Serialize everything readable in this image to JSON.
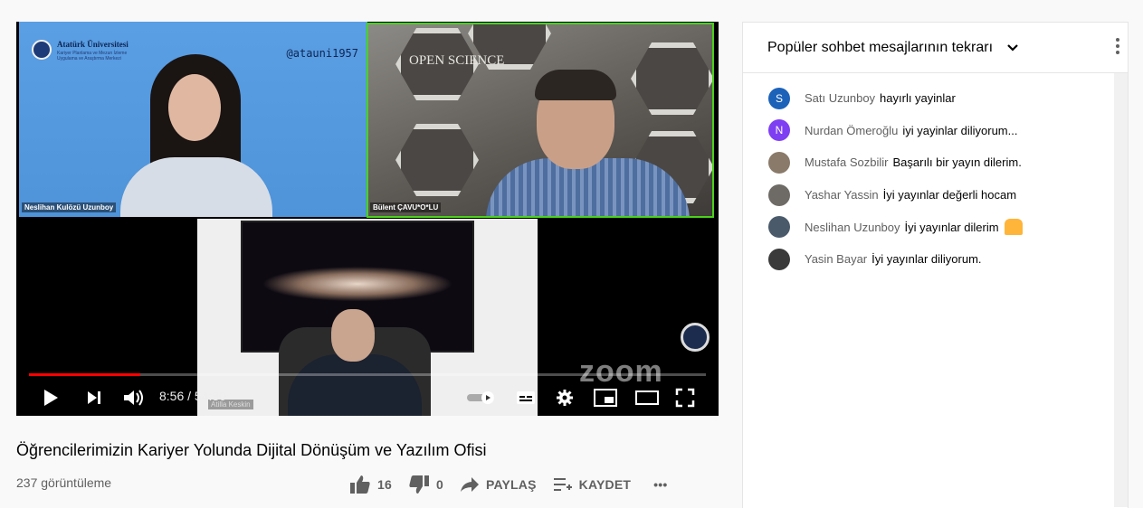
{
  "player": {
    "university_name": "Atatürk Üniversitesi",
    "university_sub": "Kariyer Planlama ve Mezun İzleme Uygulama ve Araştırma Merkezi",
    "handle": "@atauni1957",
    "open_science": "OPEN SCIENCE",
    "zoom_watermark": "zoom",
    "participants": [
      "Neslihan Kulözü Uzunboy",
      "Bülent ÇAVU*O*LU",
      "Atilla Keskin"
    ],
    "current_time": "8:56",
    "duration": "54:30",
    "time_display": "8:56 / 54:30",
    "progress_fraction": 0.164
  },
  "video": {
    "title": "Öğrencilerimizin Kariyer Yolunda Dijital Dönüşüm ve Yazılım Ofisi",
    "views": "237 görüntüleme",
    "likes": "16",
    "dislikes": "0",
    "share_label": "PAYLAŞ",
    "save_label": "KAYDET",
    "more_label": "•••"
  },
  "chat": {
    "header": "Popüler sohbet mesajlarının tekrarı",
    "messages": [
      {
        "author": "Satı Uzunboy",
        "text": "hayırlı yayinlar",
        "avatar_letter": "S",
        "avatar_color": "#1c62b9"
      },
      {
        "author": "Nurdan Ömeroğlu",
        "text": "iyi yayinlar diliyorum...",
        "avatar_letter": "N",
        "avatar_color": "#7e3ff2"
      },
      {
        "author": "Mustafa Sozbilir",
        "text": "Başarılı bir yayın dilerim.",
        "avatar_letter": "",
        "avatar_color": "#8a7a6a"
      },
      {
        "author": "Yashar Yassin",
        "text": "İyi yayınlar değerli hocam",
        "avatar_letter": "",
        "avatar_color": "#6e6a66"
      },
      {
        "author": "Neslihan Uzunboy",
        "text": "İyi yayınlar dilerim",
        "avatar_letter": "",
        "avatar_color": "#4a5a6a"
      },
      {
        "author": "Yasin Bayar",
        "text": "İyi yayınlar diliyorum.",
        "avatar_letter": "",
        "avatar_color": "#3a3a3a"
      }
    ]
  },
  "colors": {
    "progress": "#ff0000",
    "active_speaker": "#4ad21a"
  },
  "icons": [
    "play-icon",
    "next-icon",
    "volume-icon",
    "autoplay-toggle-icon",
    "subtitles-icon",
    "settings-icon",
    "miniplayer-icon",
    "theater-icon",
    "fullscreen-icon",
    "like-icon",
    "dislike-icon",
    "share-icon",
    "save-playlist-icon",
    "prayer-hands-emoji"
  ]
}
